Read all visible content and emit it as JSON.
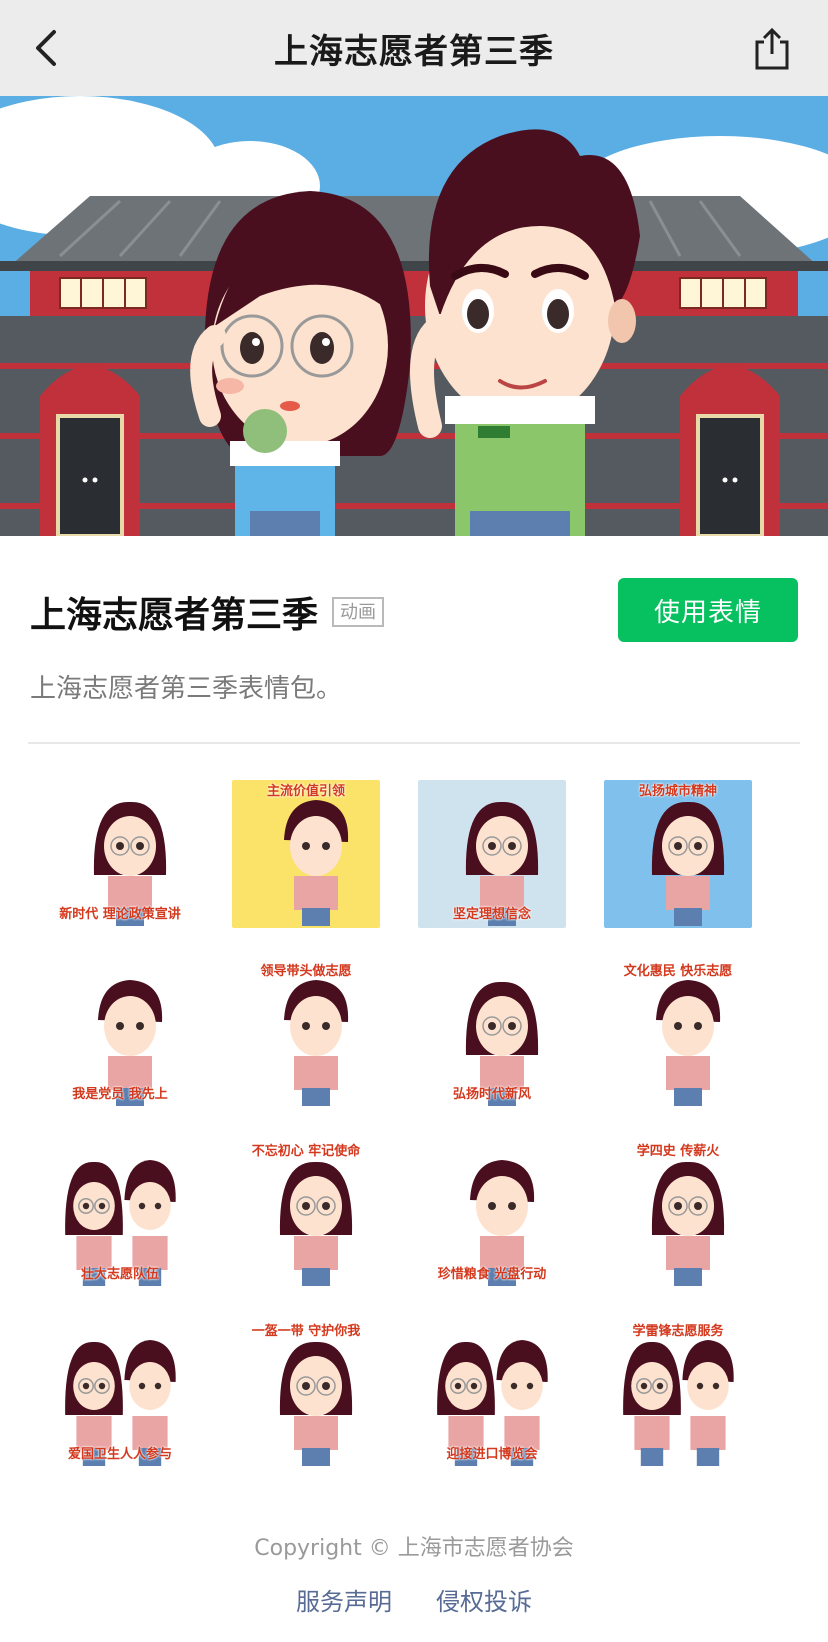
{
  "nav": {
    "title": "上海志愿者第三季",
    "back_icon": "chevron-left-icon",
    "share_icon": "share-icon"
  },
  "pack": {
    "title": "上海志愿者第三季",
    "badge": "动画",
    "use_button": "使用表情",
    "description": "上海志愿者第三季表情包。"
  },
  "colors": {
    "accent": "#07c160",
    "link": "#576b95",
    "sky": "#5aaee3",
    "building": "#555a60",
    "roof_red": "#c0313c"
  },
  "stickers": [
    {
      "text": "新时代 理论政策宣讲",
      "character": "girl"
    },
    {
      "text": "主流价值引领",
      "character": "boy"
    },
    {
      "text": "坚定理想信念",
      "character": "girl"
    },
    {
      "text": "弘扬城市精神",
      "character": "girl"
    },
    {
      "text": "我是党员 我先上",
      "character": "boy"
    },
    {
      "text": "领导带头做志愿",
      "character": "boy"
    },
    {
      "text": "弘扬时代新风",
      "character": "girl"
    },
    {
      "text": "文化惠民 快乐志愿",
      "character": "boy"
    },
    {
      "text": "壮大志愿队伍",
      "character": "pair"
    },
    {
      "text": "不忘初心 牢记使命",
      "character": "girl"
    },
    {
      "text": "珍惜粮食 光盘行动",
      "character": "boy"
    },
    {
      "text": "学四史 传薪火",
      "character": "girl"
    },
    {
      "text": "爱国卫生人人参与",
      "character": "pair"
    },
    {
      "text": "一盔一带 守护你我",
      "character": "girl"
    },
    {
      "text": "迎接进口博览会",
      "character": "pair"
    },
    {
      "text": "学雷锋志愿服务",
      "character": "pair"
    }
  ],
  "footer": {
    "copyright": "Copyright © 上海市志愿者协会",
    "link1": "服务声明",
    "link2": "侵权投诉"
  }
}
